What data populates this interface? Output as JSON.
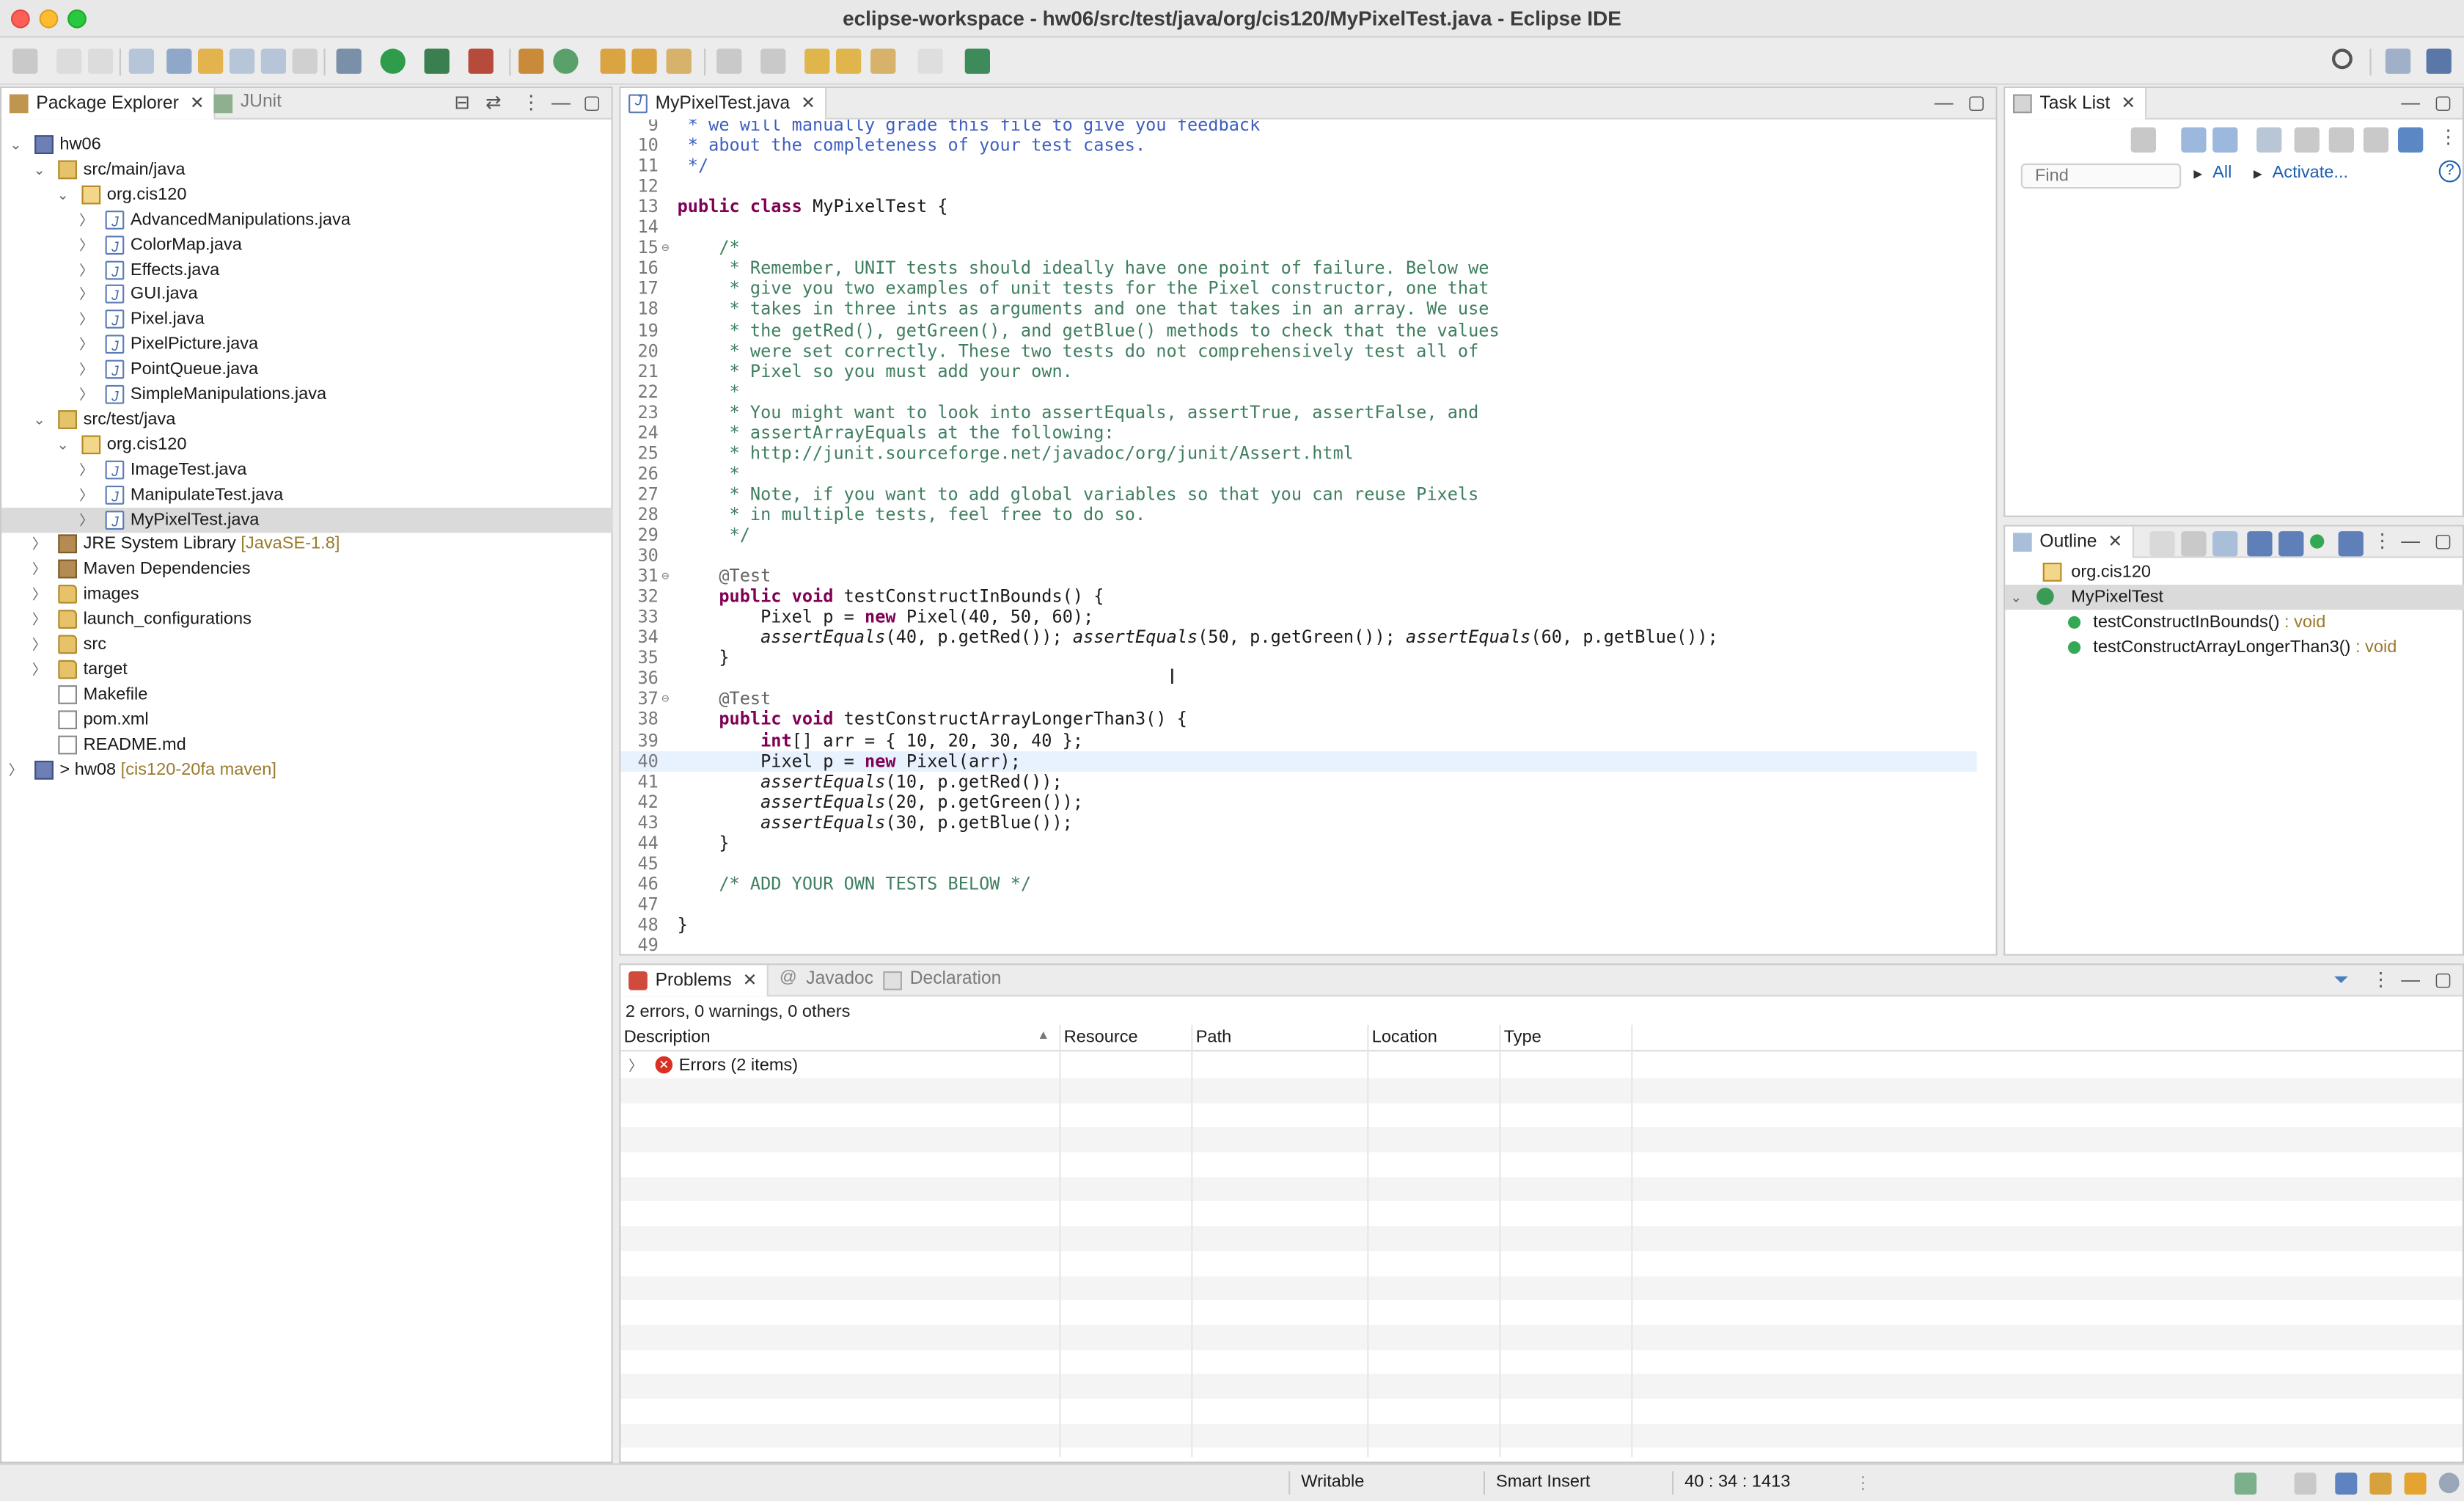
{
  "window": {
    "title": "eclipse-workspace - hw06/src/test/java/org/cis120/MyPixelTest.java - Eclipse IDE"
  },
  "package_explorer": {
    "tabs": [
      "Package Explorer",
      "JUnit"
    ],
    "tree": [
      {
        "label": "hw06",
        "deco": "",
        "depth": 0,
        "twisty": "open",
        "icon": "project"
      },
      {
        "label": "src/main/java",
        "deco": "",
        "depth": 1,
        "twisty": "open",
        "icon": "source-folder"
      },
      {
        "label": "org.cis120",
        "deco": "",
        "depth": 2,
        "twisty": "open",
        "icon": "package"
      },
      {
        "label": "AdvancedManipulations.java",
        "deco": "",
        "depth": 3,
        "twisty": "closed",
        "icon": "java-file"
      },
      {
        "label": "ColorMap.java",
        "deco": "",
        "depth": 3,
        "twisty": "closed",
        "icon": "java-file"
      },
      {
        "label": "Effects.java",
        "deco": "",
        "depth": 3,
        "twisty": "closed",
        "icon": "java-file"
      },
      {
        "label": "GUI.java",
        "deco": "",
        "depth": 3,
        "twisty": "closed",
        "icon": "java-file"
      },
      {
        "label": "Pixel.java",
        "deco": "",
        "depth": 3,
        "twisty": "closed",
        "icon": "java-file"
      },
      {
        "label": "PixelPicture.java",
        "deco": "",
        "depth": 3,
        "twisty": "closed",
        "icon": "java-file"
      },
      {
        "label": "PointQueue.java",
        "deco": "",
        "depth": 3,
        "twisty": "closed",
        "icon": "java-file"
      },
      {
        "label": "SimpleManipulations.java",
        "deco": "",
        "depth": 3,
        "twisty": "closed",
        "icon": "java-file"
      },
      {
        "label": "src/test/java",
        "deco": "",
        "depth": 1,
        "twisty": "open",
        "icon": "source-folder"
      },
      {
        "label": "org.cis120",
        "deco": "",
        "depth": 2,
        "twisty": "open",
        "icon": "package"
      },
      {
        "label": "ImageTest.java",
        "deco": "",
        "depth": 3,
        "twisty": "closed",
        "icon": "java-file"
      },
      {
        "label": "ManipulateTest.java",
        "deco": "",
        "depth": 3,
        "twisty": "closed",
        "icon": "java-file"
      },
      {
        "label": "MyPixelTest.java",
        "deco": "",
        "depth": 3,
        "twisty": "closed",
        "icon": "java-file",
        "selected": true
      },
      {
        "label": "JRE System Library",
        "deco": "[JavaSE-1.8]",
        "depth": 1,
        "twisty": "closed",
        "icon": "library"
      },
      {
        "label": "Maven Dependencies",
        "deco": "",
        "depth": 1,
        "twisty": "closed",
        "icon": "library"
      },
      {
        "label": "images",
        "deco": "",
        "depth": 1,
        "twisty": "closed",
        "icon": "folder"
      },
      {
        "label": "launch_configurations",
        "deco": "",
        "depth": 1,
        "twisty": "closed",
        "icon": "folder"
      },
      {
        "label": "src",
        "deco": "",
        "depth": 1,
        "twisty": "closed",
        "icon": "folder"
      },
      {
        "label": "target",
        "deco": "",
        "depth": 1,
        "twisty": "closed",
        "icon": "folder"
      },
      {
        "label": "Makefile",
        "deco": "",
        "depth": 1,
        "twisty": "none",
        "icon": "file"
      },
      {
        "label": "pom.xml",
        "deco": "",
        "depth": 1,
        "twisty": "none",
        "icon": "file"
      },
      {
        "label": "README.md",
        "deco": "",
        "depth": 1,
        "twisty": "none",
        "icon": "file"
      },
      {
        "label": "> hw08",
        "deco": "[cis120-20fa maven]",
        "depth": 0,
        "twisty": "closed",
        "icon": "project"
      }
    ]
  },
  "editor": {
    "tab_label": "MyPixelTest.java",
    "current_line": 40,
    "lines": [
      {
        "n": "9",
        "fold": "",
        "segs": [
          {
            "t": " * we will manually grade this file to give you feedback",
            "c": "cm"
          }
        ]
      },
      {
        "n": "10",
        "fold": "",
        "segs": [
          {
            "t": " * about the completeness of your test cases.",
            "c": "cm"
          }
        ]
      },
      {
        "n": "11",
        "fold": "",
        "segs": [
          {
            "t": " */",
            "c": "cm"
          }
        ]
      },
      {
        "n": "12",
        "fold": "",
        "segs": []
      },
      {
        "n": "13",
        "fold": "",
        "segs": [
          {
            "t": "public class",
            "c": "kw"
          },
          {
            "t": " MyPixelTest {",
            "c": ""
          }
        ]
      },
      {
        "n": "14",
        "fold": "",
        "segs": []
      },
      {
        "n": "15",
        "fold": "⊖",
        "segs": [
          {
            "t": "    /*",
            "c": "cg"
          }
        ]
      },
      {
        "n": "16",
        "fold": "",
        "segs": [
          {
            "t": "     * Remember, UNIT tests should ideally have one point of failure. Below we",
            "c": "cg"
          }
        ]
      },
      {
        "n": "17",
        "fold": "",
        "segs": [
          {
            "t": "     * give you two examples of unit tests for the Pixel constructor, one that",
            "c": "cg"
          }
        ]
      },
      {
        "n": "18",
        "fold": "",
        "segs": [
          {
            "t": "     * takes in three ints as arguments and one that takes in an array. We use",
            "c": "cg"
          }
        ]
      },
      {
        "n": "19",
        "fold": "",
        "segs": [
          {
            "t": "     * the getRed(), getGreen(), and getBlue() methods to check that the values",
            "c": "cg"
          }
        ]
      },
      {
        "n": "20",
        "fold": "",
        "segs": [
          {
            "t": "     * were set correctly. These two tests do not comprehensively test all of",
            "c": "cg"
          }
        ]
      },
      {
        "n": "21",
        "fold": "",
        "segs": [
          {
            "t": "     * Pixel so you must add your own.",
            "c": "cg"
          }
        ]
      },
      {
        "n": "22",
        "fold": "",
        "segs": [
          {
            "t": "     *",
            "c": "cg"
          }
        ]
      },
      {
        "n": "23",
        "fold": "",
        "segs": [
          {
            "t": "     * You might want to look into assertEquals, assertTrue, assertFalse, and",
            "c": "cg"
          }
        ]
      },
      {
        "n": "24",
        "fold": "",
        "segs": [
          {
            "t": "     * assertArrayEquals at the following:",
            "c": "cg"
          }
        ]
      },
      {
        "n": "25",
        "fold": "",
        "segs": [
          {
            "t": "     * http://junit.sourceforge.net/javadoc/org/junit/Assert.html",
            "c": "cg"
          }
        ]
      },
      {
        "n": "26",
        "fold": "",
        "segs": [
          {
            "t": "     *",
            "c": "cg"
          }
        ]
      },
      {
        "n": "27",
        "fold": "",
        "segs": [
          {
            "t": "     * Note, if you want to add global variables so that you can reuse Pixels",
            "c": "cg"
          }
        ]
      },
      {
        "n": "28",
        "fold": "",
        "segs": [
          {
            "t": "     * in multiple tests, feel free to do so.",
            "c": "cg"
          }
        ]
      },
      {
        "n": "29",
        "fold": "",
        "segs": [
          {
            "t": "     */",
            "c": "cg"
          }
        ]
      },
      {
        "n": "30",
        "fold": "",
        "segs": []
      },
      {
        "n": "31",
        "fold": "⊖",
        "segs": [
          {
            "t": "    @Test",
            "c": "an"
          }
        ]
      },
      {
        "n": "32",
        "fold": "",
        "segs": [
          {
            "t": "    public void",
            "c": "kw"
          },
          {
            "t": " testConstructInBounds() {",
            "c": ""
          }
        ]
      },
      {
        "n": "33",
        "fold": "",
        "segs": [
          {
            "t": "        Pixel p = ",
            "c": ""
          },
          {
            "t": "new",
            "c": "kw"
          },
          {
            "t": " Pixel(40, 50, 60);",
            "c": ""
          }
        ]
      },
      {
        "n": "34",
        "fold": "",
        "segs": [
          {
            "t": "        ",
            "c": ""
          },
          {
            "t": "assertEquals",
            "c": "it"
          },
          {
            "t": "(40, p.getRed()); ",
            "c": ""
          },
          {
            "t": "assertEquals",
            "c": "it"
          },
          {
            "t": "(50, p.getGreen()); ",
            "c": ""
          },
          {
            "t": "assertEquals",
            "c": "it"
          },
          {
            "t": "(60, p.getBlue());",
            "c": ""
          }
        ]
      },
      {
        "n": "35",
        "fold": "",
        "segs": [
          {
            "t": "    }",
            "c": ""
          }
        ]
      },
      {
        "n": "36",
        "fold": "",
        "segs": []
      },
      {
        "n": "37",
        "fold": "⊖",
        "segs": [
          {
            "t": "    @Test",
            "c": "an"
          }
        ]
      },
      {
        "n": "38",
        "fold": "",
        "segs": [
          {
            "t": "    public void",
            "c": "kw"
          },
          {
            "t": " testConstructArrayLongerThan3() {",
            "c": ""
          }
        ]
      },
      {
        "n": "39",
        "fold": "",
        "segs": [
          {
            "t": "        ",
            "c": ""
          },
          {
            "t": "int",
            "c": "kw"
          },
          {
            "t": "[] arr = { 10, 20, 30, 40 };",
            "c": ""
          }
        ]
      },
      {
        "n": "40",
        "fold": "",
        "segs": [
          {
            "t": "        Pixel p = ",
            "c": ""
          },
          {
            "t": "new",
            "c": "kw"
          },
          {
            "t": " Pixel(arr);",
            "c": ""
          }
        ]
      },
      {
        "n": "41",
        "fold": "",
        "segs": [
          {
            "t": "        ",
            "c": ""
          },
          {
            "t": "assertEquals",
            "c": "it"
          },
          {
            "t": "(10, p.getRed());",
            "c": ""
          }
        ]
      },
      {
        "n": "42",
        "fold": "",
        "segs": [
          {
            "t": "        ",
            "c": ""
          },
          {
            "t": "assertEquals",
            "c": "it"
          },
          {
            "t": "(20, p.getGreen());",
            "c": ""
          }
        ]
      },
      {
        "n": "43",
        "fold": "",
        "segs": [
          {
            "t": "        ",
            "c": ""
          },
          {
            "t": "assertEquals",
            "c": "it"
          },
          {
            "t": "(30, p.getBlue());",
            "c": ""
          }
        ]
      },
      {
        "n": "44",
        "fold": "",
        "segs": [
          {
            "t": "    }",
            "c": ""
          }
        ]
      },
      {
        "n": "45",
        "fold": "",
        "segs": []
      },
      {
        "n": "46",
        "fold": "",
        "segs": [
          {
            "t": "    /* ADD YOUR OWN TESTS BELOW */",
            "c": "cg"
          }
        ]
      },
      {
        "n": "47",
        "fold": "",
        "segs": []
      },
      {
        "n": "48",
        "fold": "",
        "segs": [
          {
            "t": "}",
            "c": ""
          }
        ]
      },
      {
        "n": "49",
        "fold": "",
        "segs": []
      }
    ]
  },
  "task_list": {
    "tab_label": "Task List",
    "find_placeholder": "Find",
    "all_label": "All",
    "activate_label": "Activate..."
  },
  "outline": {
    "tab_label": "Outline",
    "items": [
      {
        "label": "org.cis120",
        "ret": "",
        "depth": 0,
        "icon": "package"
      },
      {
        "label": "MyPixelTest",
        "ret": "",
        "depth": 0,
        "icon": "class",
        "selected": true
      },
      {
        "label": "testConstructInBounds()",
        "ret": " : void",
        "depth": 1,
        "icon": "method"
      },
      {
        "label": "testConstructArrayLongerThan3()",
        "ret": " : void",
        "depth": 1,
        "icon": "method"
      }
    ]
  },
  "problems": {
    "tabs": [
      "Problems",
      "Javadoc",
      "Declaration"
    ],
    "summary": "2 errors, 0 warnings, 0 others",
    "columns": [
      "Description",
      "Resource",
      "Path",
      "Location",
      "Type"
    ],
    "group_label": "Errors (2 items)"
  },
  "status_bar": {
    "writable": "Writable",
    "insert_mode": "Smart Insert",
    "position": "40 : 34 : 1413"
  },
  "colors": {
    "keyword": "#7f0055",
    "javadoc": "#3f5fbf",
    "comment": "#3f7f5f",
    "current_line": "#e8f2fe",
    "error": "#d93025"
  }
}
